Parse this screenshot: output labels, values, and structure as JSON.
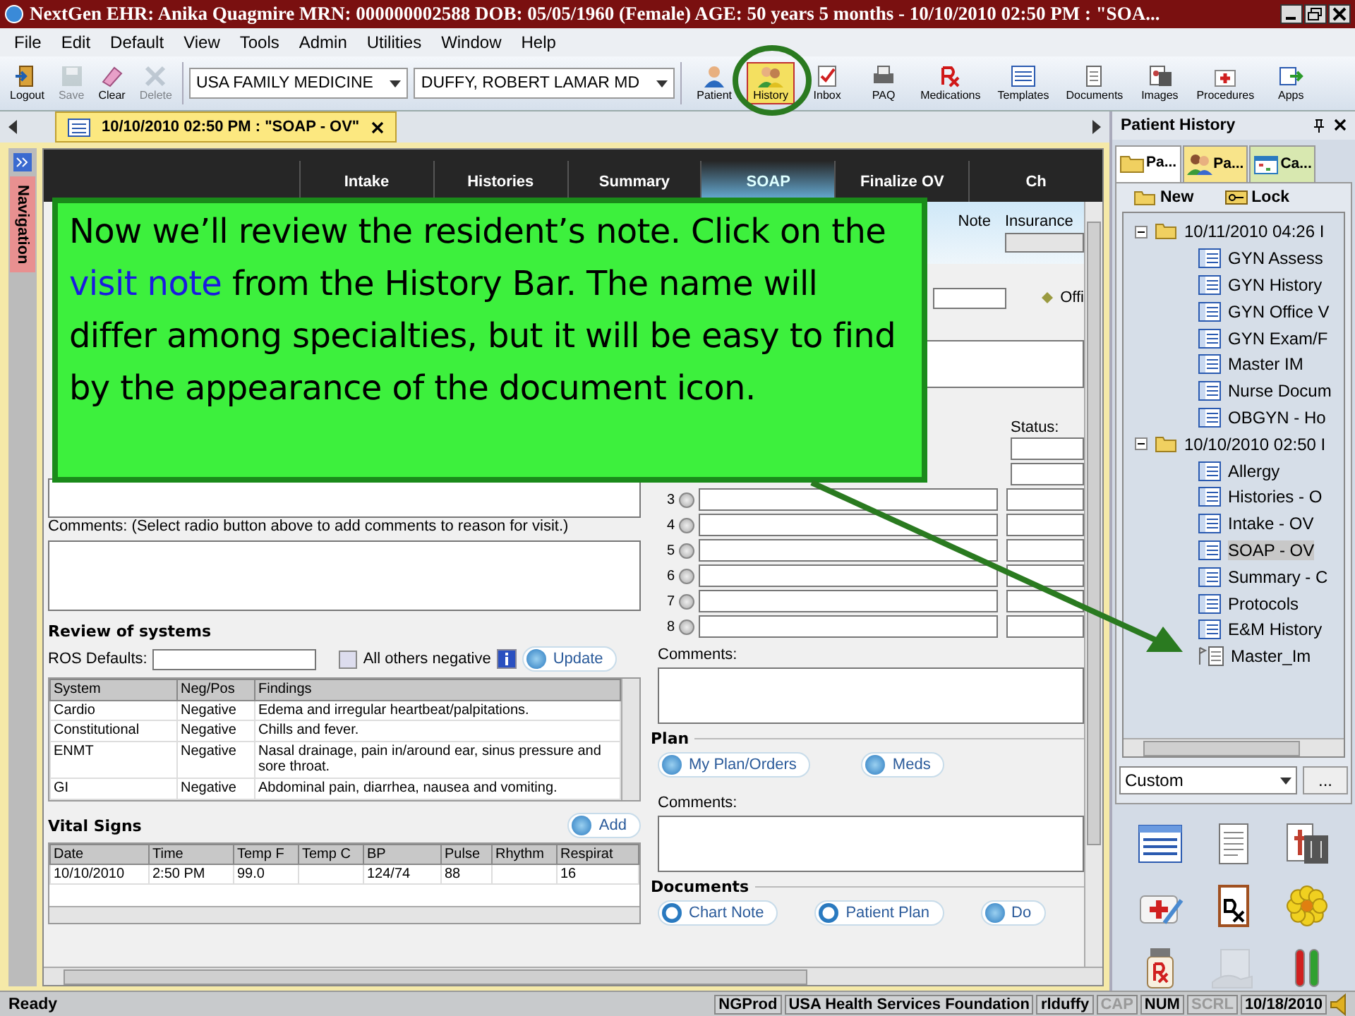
{
  "window": {
    "title": "NextGen EHR: Anika Quagmire  MRN: 000000002588  DOB: 05/05/1960  (Female)  AGE: 50 years 5 months - 10/10/2010 02:50 PM : \"SOA..."
  },
  "menu": [
    "File",
    "Edit",
    "Default",
    "View",
    "Tools",
    "Admin",
    "Utilities",
    "Window",
    "Help"
  ],
  "toolbar": {
    "actions": [
      {
        "label": "Logout",
        "kind": "door",
        "disabled": false
      },
      {
        "label": "Save",
        "kind": "disk",
        "disabled": true
      },
      {
        "label": "Clear",
        "kind": "eraser",
        "disabled": false
      },
      {
        "label": "Delete",
        "kind": "cross",
        "disabled": true
      }
    ],
    "location": "USA FAMILY MEDICINE",
    "provider": "DUFFY, ROBERT  LAMAR MD",
    "tools": [
      {
        "label": "Patient",
        "kind": "person",
        "selected": false
      },
      {
        "label": "History",
        "kind": "people",
        "selected": true
      },
      {
        "label": "Inbox",
        "kind": "check",
        "selected": false
      },
      {
        "label": "PAQ",
        "kind": "printer",
        "selected": false
      },
      {
        "label": "Medications",
        "kind": "rx",
        "selected": false
      },
      {
        "label": "Templates",
        "kind": "list",
        "selected": false
      },
      {
        "label": "Documents",
        "kind": "document",
        "selected": false
      },
      {
        "label": "Images",
        "kind": "image",
        "selected": false
      },
      {
        "label": "Procedures",
        "kind": "kit",
        "selected": false
      },
      {
        "label": "Apps",
        "kind": "apps",
        "selected": false
      }
    ]
  },
  "document_tab": {
    "label": "10/10/2010 02:50 PM : \"SOAP - OV\""
  },
  "navigation_tab": "Navigation",
  "workflow_tabs": [
    {
      "label": "Intake",
      "selected": false
    },
    {
      "label": "Histories",
      "selected": false
    },
    {
      "label": "Summary",
      "selected": false
    },
    {
      "label": "SOAP",
      "selected": true
    },
    {
      "label": "Finalize OV",
      "selected": false
    },
    {
      "label": "Ch",
      "selected": false
    }
  ],
  "left": {
    "reason_comments_label": "Comments: (Select radio button above to add comments to reason for visit.)",
    "ros": {
      "title": "Review of systems",
      "defaults_label": "ROS Defaults:",
      "all_negative": {
        "label": "All others negative",
        "checked": false
      },
      "update": "Update",
      "columns": [
        "System",
        "Neg/Pos",
        "Findings"
      ],
      "rows": [
        [
          "Cardio",
          "Negative",
          "Edema and irregular heartbeat/palpitations."
        ],
        [
          "Constitutional",
          "Negative",
          "Chills and fever."
        ],
        [
          "ENMT",
          "Negative",
          "Nasal drainage, pain in/around ear, sinus pressure and sore throat."
        ],
        [
          "GI",
          "Negative",
          "Abdominal pain, diarrhea, nausea and vomiting."
        ]
      ]
    },
    "vitals": {
      "title": "Vital Signs",
      "add": "Add",
      "columns": [
        "Date",
        "Time",
        "Temp F",
        "Temp C",
        "BP",
        "Pulse",
        "Rhythm",
        "Respirat"
      ],
      "rows": [
        [
          "10/10/2010",
          "2:50 PM",
          "99.0",
          null,
          "124/74",
          "88",
          null,
          "16"
        ]
      ]
    }
  },
  "right": {
    "note": "Note",
    "insurance": "Insurance",
    "office": "Offi",
    "status_label": "Status:",
    "assessment_rows": [
      {
        "number": "3",
        "selected": false
      },
      {
        "number": "4",
        "selected": false
      },
      {
        "number": "5",
        "selected": false
      },
      {
        "number": "6",
        "selected": false
      },
      {
        "number": "7",
        "selected": false
      },
      {
        "number": "8",
        "selected": false
      }
    ],
    "comments_label": "Comments:",
    "plan_title": "Plan",
    "plan_buttons": [
      "My Plan/Orders",
      "Meds"
    ],
    "plan_comments_label": "Comments:",
    "documents_title": "Documents",
    "document_buttons": [
      {
        "label": "Chart Note",
        "kind": "document"
      },
      {
        "label": "Patient Plan",
        "kind": "document"
      },
      {
        "label": "Do",
        "kind": "play"
      }
    ]
  },
  "callout": {
    "parts": [
      {
        "text": "Now we’ll review the resident’s note. Click on the ",
        "highlight": false
      },
      {
        "text": "visit note",
        "highlight": true
      },
      {
        "text": " from the History Bar.  The name will differ among specialties, but it will be easy to find by the appearance of the document icon.",
        "highlight": false
      }
    ]
  },
  "history_panel": {
    "title": "Patient History",
    "tabs": [
      {
        "label": "Pa...",
        "kind": "folder",
        "selected": true
      },
      {
        "label": "Pa...",
        "kind": "people",
        "selected": false
      },
      {
        "label": "Ca...",
        "kind": "calendar",
        "selected": false
      }
    ],
    "new": "New",
    "lock": "Lock",
    "tree": [
      {
        "label": "10/11/2010 04:26 I",
        "expanded": true,
        "children": [
          {
            "label": "GYN Assess",
            "kind": "form",
            "selected": false
          },
          {
            "label": "GYN History",
            "kind": "form",
            "selected": false
          },
          {
            "label": "GYN Office V",
            "kind": "form",
            "selected": false
          },
          {
            "label": "GYN Exam/F",
            "kind": "form",
            "selected": false
          },
          {
            "label": "Master IM",
            "kind": "form",
            "selected": false
          },
          {
            "label": "Nurse Docum",
            "kind": "form",
            "selected": false
          },
          {
            "label": "OBGYN - Ho",
            "kind": "form",
            "selected": false
          }
        ]
      },
      {
        "label": "10/10/2010 02:50 I",
        "expanded": true,
        "children": [
          {
            "label": "Allergy",
            "kind": "form",
            "selected": false
          },
          {
            "label": "Histories - O",
            "kind": "form",
            "selected": false
          },
          {
            "label": "Intake - OV",
            "kind": "form",
            "selected": false
          },
          {
            "label": "SOAP - OV",
            "kind": "form",
            "selected": true
          },
          {
            "label": "Summary - C",
            "kind": "form",
            "selected": false
          },
          {
            "label": "Protocols",
            "kind": "form",
            "selected": false
          },
          {
            "label": "E&M History",
            "kind": "form",
            "selected": false
          },
          {
            "label": "Master_Im",
            "kind": "note",
            "selected": false
          }
        ]
      }
    ],
    "filter": "Custom",
    "more": "...",
    "launchers": [
      {
        "kind": "list",
        "disabled": false
      },
      {
        "kind": "document",
        "disabled": false
      },
      {
        "kind": "xray",
        "disabled": false
      },
      {
        "kind": "kit",
        "disabled": false
      },
      {
        "kind": "dx",
        "disabled": false
      },
      {
        "kind": "flower",
        "disabled": false
      },
      {
        "kind": "rx",
        "disabled": false
      },
      {
        "kind": "hand",
        "disabled": true
      },
      {
        "kind": "tubes",
        "disabled": false
      }
    ]
  },
  "status_bar": {
    "message": "Ready",
    "segments": [
      {
        "text": "NGProd",
        "on": true
      },
      {
        "text": "USA Health Services Foundation",
        "on": true
      },
      {
        "text": "rlduffy",
        "on": true
      },
      {
        "text": "CAP",
        "on": false
      },
      {
        "text": "NUM",
        "on": true
      },
      {
        "text": "SCRL",
        "on": false
      },
      {
        "text": "10/18/2010",
        "on": true
      }
    ]
  }
}
